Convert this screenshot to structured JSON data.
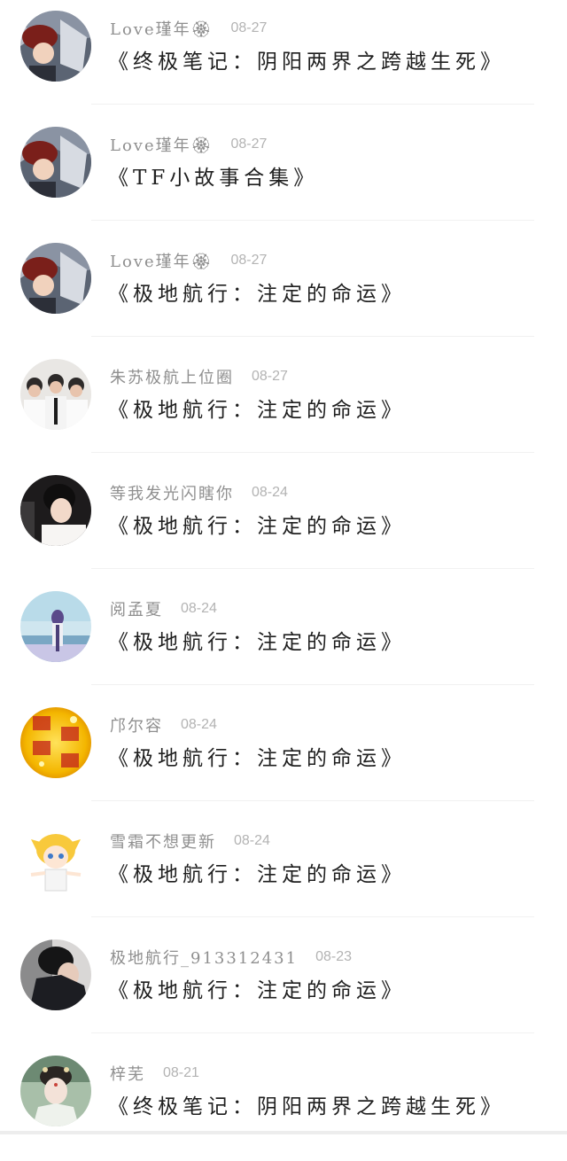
{
  "items": [
    {
      "username": "Love瑾年🏵",
      "date": "08-27",
      "title": "《终极笔记：阴阳两界之跨越生死》",
      "avatar_icon": "anime-character-avatar-icon"
    },
    {
      "username": "Love瑾年🏵",
      "date": "08-27",
      "title": "《TF小故事合集》",
      "avatar_icon": "anime-character-avatar-icon"
    },
    {
      "username": "Love瑾年🏵",
      "date": "08-27",
      "title": "《极地航行：注定的命运》",
      "avatar_icon": "anime-character-avatar-icon"
    },
    {
      "username": "朱苏极航上位圈",
      "date": "08-27",
      "title": "《极地航行：注定的命运》",
      "avatar_icon": "group-photo-avatar-icon"
    },
    {
      "username": "等我发光闪瞎你",
      "date": "08-24",
      "title": "《极地航行：注定的命运》",
      "avatar_icon": "person-photo-avatar-icon"
    },
    {
      "username": "阅孟夏",
      "date": "08-24",
      "title": "《极地航行：注定的命运》",
      "avatar_icon": "sky-photo-avatar-icon"
    },
    {
      "username": "邝尔容",
      "date": "08-24",
      "title": "《极地航行：注定的命运》",
      "avatar_icon": "new-year-greeting-avatar-icon"
    },
    {
      "username": "雪霜不想更新",
      "date": "08-24",
      "title": "《极地航行：注定的命运》",
      "avatar_icon": "cartoon-boy-avatar-icon"
    },
    {
      "username": "极地航行_913312431",
      "date": "08-23",
      "title": "《极地航行：注定的命运》",
      "avatar_icon": "dark-photo-avatar-icon"
    },
    {
      "username": "梓芜",
      "date": "08-21",
      "title": "《终极笔记：阴阳两界之跨越生死》",
      "avatar_icon": "costume-portrait-avatar-icon"
    }
  ]
}
